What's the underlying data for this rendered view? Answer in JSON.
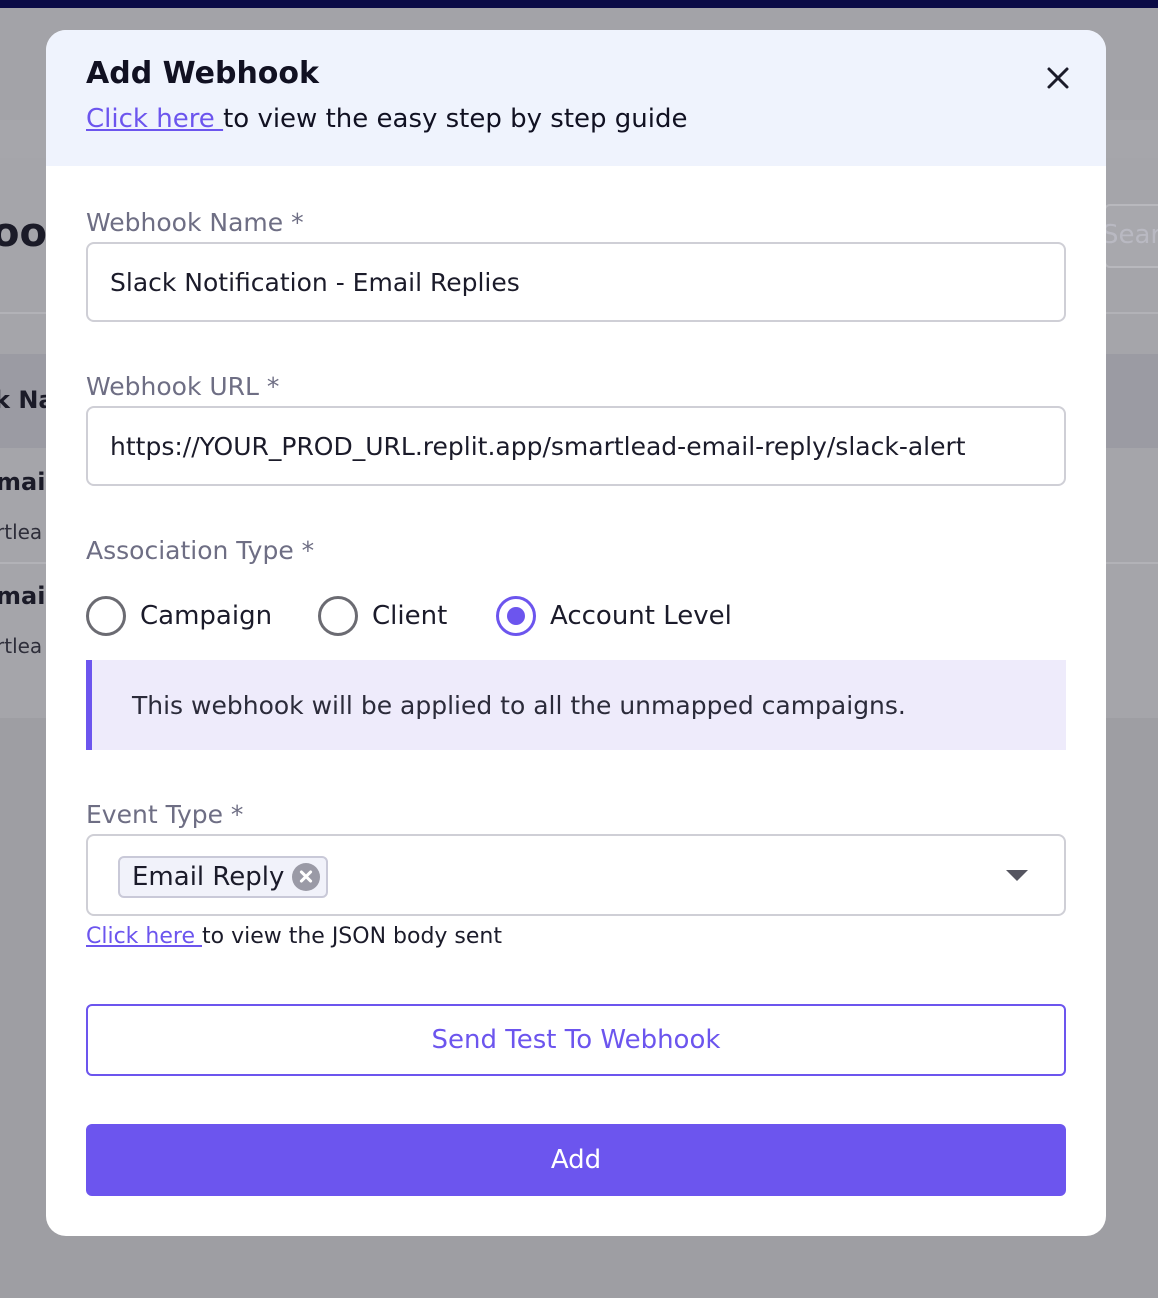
{
  "background": {
    "page_title_fragment": "ool",
    "column_header_fragment": "k Na",
    "rows": [
      {
        "name": "mai",
        "sub": "rtlea"
      },
      {
        "name": "mail",
        "sub": "rtlea"
      }
    ],
    "search_placeholder": "Sear"
  },
  "modal": {
    "title": "Add Webhook",
    "guide_link": "Click here ",
    "guide_text": "to view the easy step by step guide",
    "close_icon": "close-icon",
    "webhook_name": {
      "label": "Webhook Name *",
      "value": "Slack Notification - Email Replies"
    },
    "webhook_url": {
      "label": "Webhook URL *",
      "value": "https://YOUR_PROD_URL.replit.app/smartlead-email-reply/slack-alert"
    },
    "association_type": {
      "label": "Association Type *",
      "options": [
        {
          "label": "Campaign",
          "checked": false
        },
        {
          "label": "Client",
          "checked": false
        },
        {
          "label": "Account Level",
          "checked": true
        }
      ],
      "info": "This webhook will be applied to all the unmapped campaigns."
    },
    "event_type": {
      "label": "Event Type *",
      "selected": [
        "Email Reply"
      ],
      "json_link": "Click here ",
      "json_text": "to view the JSON body sent"
    },
    "send_test_label": "Send Test To Webhook",
    "add_label": "Add"
  },
  "colors": {
    "accent": "#6c55ee",
    "overlay": "#9e9ea3",
    "topbar": "#0b0b46",
    "header_bg": "#eff3fd",
    "info_bg": "#eeebfb"
  }
}
